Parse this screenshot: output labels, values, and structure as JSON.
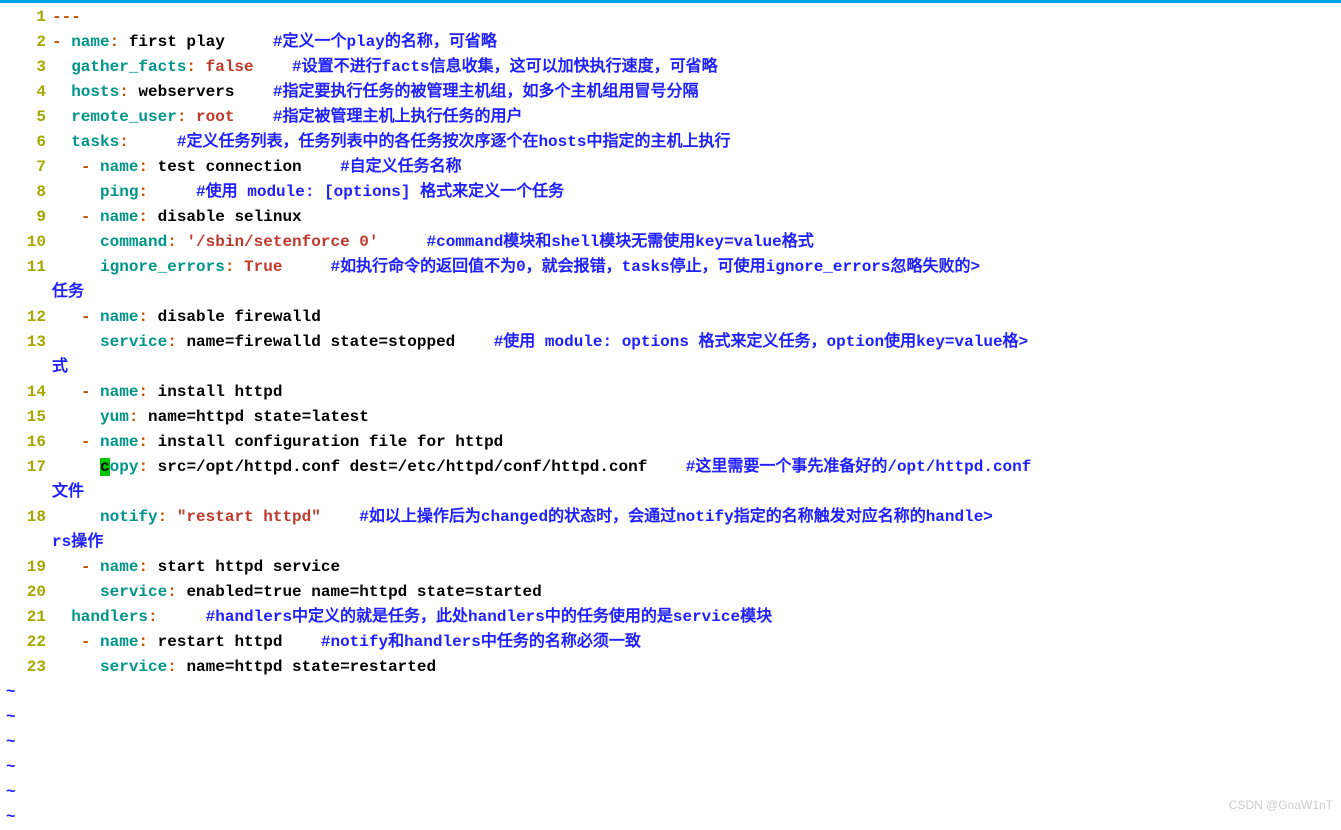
{
  "watermark": "CSDN @GnaW1nT",
  "tildes": 6,
  "lines": [
    {
      "n": 1,
      "segs": [
        {
          "c": "punct",
          "t": "---"
        }
      ]
    },
    {
      "n": 2,
      "segs": [
        {
          "c": "punct",
          "t": "- "
        },
        {
          "c": "key",
          "t": "name"
        },
        {
          "c": "punct",
          "t": ": "
        },
        {
          "c": "val",
          "t": "first play     "
        },
        {
          "c": "cmt",
          "t": "#定义一个play的名称，可省略"
        }
      ]
    },
    {
      "n": 3,
      "segs": [
        {
          "c": "val",
          "t": "  "
        },
        {
          "c": "key",
          "t": "gather_facts"
        },
        {
          "c": "punct",
          "t": ": "
        },
        {
          "c": "str",
          "t": "false"
        },
        {
          "c": "val",
          "t": "    "
        },
        {
          "c": "cmt",
          "t": "#设置不进行facts信息收集，这可以加快执行速度，可省略"
        }
      ]
    },
    {
      "n": 4,
      "segs": [
        {
          "c": "val",
          "t": "  "
        },
        {
          "c": "key",
          "t": "hosts"
        },
        {
          "c": "punct",
          "t": ": "
        },
        {
          "c": "val",
          "t": "webservers    "
        },
        {
          "c": "cmt",
          "t": "#指定要执行任务的被管理主机组，如多个主机组用冒号分隔"
        }
      ]
    },
    {
      "n": 5,
      "segs": [
        {
          "c": "val",
          "t": "  "
        },
        {
          "c": "key",
          "t": "remote_user"
        },
        {
          "c": "punct",
          "t": ": "
        },
        {
          "c": "str",
          "t": "root"
        },
        {
          "c": "val",
          "t": "    "
        },
        {
          "c": "cmt",
          "t": "#指定被管理主机上执行任务的用户"
        }
      ]
    },
    {
      "n": 6,
      "segs": [
        {
          "c": "val",
          "t": "  "
        },
        {
          "c": "key",
          "t": "tasks"
        },
        {
          "c": "punct",
          "t": ":"
        },
        {
          "c": "val",
          "t": "     "
        },
        {
          "c": "cmt",
          "t": "#定义任务列表，任务列表中的各任务按次序逐个在hosts中指定的主机上执行"
        }
      ]
    },
    {
      "n": 7,
      "segs": [
        {
          "c": "val",
          "t": "   "
        },
        {
          "c": "punct",
          "t": "- "
        },
        {
          "c": "key",
          "t": "name"
        },
        {
          "c": "punct",
          "t": ": "
        },
        {
          "c": "val",
          "t": "test connection    "
        },
        {
          "c": "cmt",
          "t": "#自定义任务名称"
        }
      ]
    },
    {
      "n": 8,
      "segs": [
        {
          "c": "val",
          "t": "     "
        },
        {
          "c": "key",
          "t": "ping"
        },
        {
          "c": "punct",
          "t": ":"
        },
        {
          "c": "val",
          "t": "     "
        },
        {
          "c": "cmt",
          "t": "#使用 module: [options] 格式来定义一个任务"
        }
      ]
    },
    {
      "n": 9,
      "segs": [
        {
          "c": "val",
          "t": "   "
        },
        {
          "c": "punct",
          "t": "- "
        },
        {
          "c": "key",
          "t": "name"
        },
        {
          "c": "punct",
          "t": ": "
        },
        {
          "c": "val",
          "t": "disable selinux"
        }
      ]
    },
    {
      "n": 10,
      "segs": [
        {
          "c": "val",
          "t": "     "
        },
        {
          "c": "key",
          "t": "command"
        },
        {
          "c": "punct",
          "t": ": "
        },
        {
          "c": "str",
          "t": "'/sbin/setenforce 0'"
        },
        {
          "c": "val",
          "t": "     "
        },
        {
          "c": "cmt",
          "t": "#command模块和shell模块无需使用key=value格式"
        }
      ]
    },
    {
      "n": 11,
      "segs": [
        {
          "c": "val",
          "t": "     "
        },
        {
          "c": "key",
          "t": "ignore_errors"
        },
        {
          "c": "punct",
          "t": ": "
        },
        {
          "c": "str",
          "t": "True"
        },
        {
          "c": "val",
          "t": "     "
        },
        {
          "c": "cmt",
          "t": "#如执行命令的返回值不为0，就会报错，tasks停止，可使用ignore_errors忽略失败的>"
        }
      ]
    },
    {
      "n": 11,
      "wrap": true,
      "segs": [
        {
          "c": "cmt",
          "t": "任务"
        }
      ]
    },
    {
      "n": 12,
      "segs": [
        {
          "c": "val",
          "t": "   "
        },
        {
          "c": "punct",
          "t": "- "
        },
        {
          "c": "key",
          "t": "name"
        },
        {
          "c": "punct",
          "t": ": "
        },
        {
          "c": "val",
          "t": "disable firewalld"
        }
      ]
    },
    {
      "n": 13,
      "segs": [
        {
          "c": "val",
          "t": "     "
        },
        {
          "c": "key",
          "t": "service"
        },
        {
          "c": "punct",
          "t": ": "
        },
        {
          "c": "val",
          "t": "name=firewalld state=stopped    "
        },
        {
          "c": "cmt",
          "t": "#使用 module: options 格式来定义任务，option使用key=value格>"
        }
      ]
    },
    {
      "n": 13,
      "wrap": true,
      "segs": [
        {
          "c": "cmt",
          "t": "式"
        }
      ]
    },
    {
      "n": 14,
      "segs": [
        {
          "c": "val",
          "t": "   "
        },
        {
          "c": "punct",
          "t": "- "
        },
        {
          "c": "key",
          "t": "name"
        },
        {
          "c": "punct",
          "t": ": "
        },
        {
          "c": "val",
          "t": "install httpd"
        }
      ]
    },
    {
      "n": 15,
      "segs": [
        {
          "c": "val",
          "t": "     "
        },
        {
          "c": "key",
          "t": "yum"
        },
        {
          "c": "punct",
          "t": ": "
        },
        {
          "c": "val",
          "t": "name=httpd state=latest"
        }
      ]
    },
    {
      "n": 16,
      "segs": [
        {
          "c": "val",
          "t": "   "
        },
        {
          "c": "punct",
          "t": "- "
        },
        {
          "c": "key",
          "t": "name"
        },
        {
          "c": "punct",
          "t": ": "
        },
        {
          "c": "val",
          "t": "install configuration file for httpd"
        }
      ]
    },
    {
      "n": 17,
      "segs": [
        {
          "c": "val",
          "t": "     "
        },
        {
          "c": "cursor",
          "t": "c"
        },
        {
          "c": "key",
          "t": "opy"
        },
        {
          "c": "punct",
          "t": ": "
        },
        {
          "c": "val",
          "t": "src=/opt/httpd.conf dest=/etc/httpd/conf/httpd.conf    "
        },
        {
          "c": "cmt",
          "t": "#这里需要一个事先准备好的/opt/httpd.conf"
        }
      ]
    },
    {
      "n": 17,
      "wrap": true,
      "segs": [
        {
          "c": "cmt",
          "t": "文件"
        }
      ]
    },
    {
      "n": 18,
      "segs": [
        {
          "c": "val",
          "t": "     "
        },
        {
          "c": "key",
          "t": "notify"
        },
        {
          "c": "punct",
          "t": ": "
        },
        {
          "c": "str",
          "t": "\"restart httpd\""
        },
        {
          "c": "val",
          "t": "    "
        },
        {
          "c": "cmt",
          "t": "#如以上操作后为changed的状态时，会通过notify指定的名称触发对应名称的handle>"
        }
      ]
    },
    {
      "n": 18,
      "wrap": true,
      "segs": [
        {
          "c": "cmt",
          "t": "rs操作"
        }
      ]
    },
    {
      "n": 19,
      "segs": [
        {
          "c": "val",
          "t": "   "
        },
        {
          "c": "punct",
          "t": "- "
        },
        {
          "c": "key",
          "t": "name"
        },
        {
          "c": "punct",
          "t": ": "
        },
        {
          "c": "val",
          "t": "start httpd service"
        }
      ]
    },
    {
      "n": 20,
      "segs": [
        {
          "c": "val",
          "t": "     "
        },
        {
          "c": "key",
          "t": "service"
        },
        {
          "c": "punct",
          "t": ": "
        },
        {
          "c": "val",
          "t": "enabled=true name=httpd state=started"
        }
      ]
    },
    {
      "n": 21,
      "segs": [
        {
          "c": "val",
          "t": "  "
        },
        {
          "c": "key",
          "t": "handlers"
        },
        {
          "c": "punct",
          "t": ":"
        },
        {
          "c": "val",
          "t": "     "
        },
        {
          "c": "cmt",
          "t": "#handlers中定义的就是任务，此处handlers中的任务使用的是service模块"
        }
      ]
    },
    {
      "n": 22,
      "segs": [
        {
          "c": "val",
          "t": "   "
        },
        {
          "c": "punct",
          "t": "- "
        },
        {
          "c": "key",
          "t": "name"
        },
        {
          "c": "punct",
          "t": ": "
        },
        {
          "c": "val",
          "t": "restart httpd    "
        },
        {
          "c": "cmt",
          "t": "#notify和handlers中任务的名称必须一致"
        }
      ]
    },
    {
      "n": 23,
      "segs": [
        {
          "c": "val",
          "t": "     "
        },
        {
          "c": "key",
          "t": "service"
        },
        {
          "c": "punct",
          "t": ": "
        },
        {
          "c": "val",
          "t": "name=httpd state=restarted"
        }
      ]
    }
  ]
}
